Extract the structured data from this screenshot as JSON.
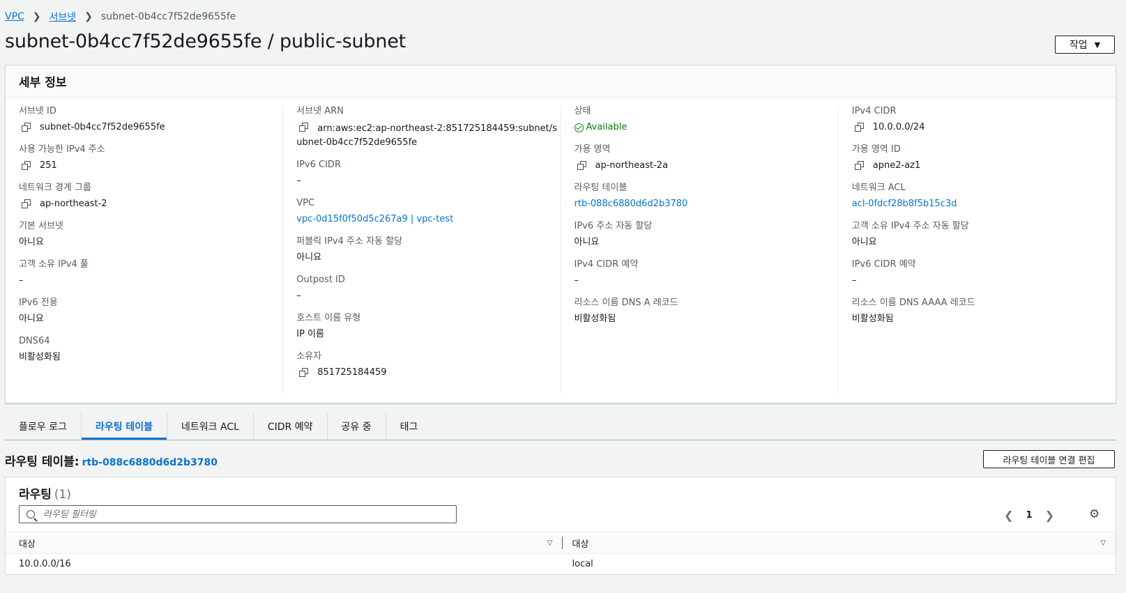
{
  "breadcrumb": {
    "items": [
      "VPC",
      "서브넷"
    ],
    "current": "subnet-0b4cc7f52de9655fe"
  },
  "title": "subnet-0b4cc7f52de9655fe / public-subnet",
  "actions_label": "작업",
  "details": {
    "header": "세부 정보",
    "col1": [
      {
        "label": "서브넷 ID",
        "value": "subnet-0b4cc7f52de9655fe"
      },
      {
        "label": "사용 가능한 IPv4 주소",
        "value": "251"
      },
      {
        "label": "네트워크 경계 그룹",
        "value": "ap-northeast-2"
      },
      {
        "label": "기본 서브넷",
        "value": "아니요"
      },
      {
        "label": "고객 소유 IPv4 풀",
        "value": "–"
      },
      {
        "label": "IPv6 전용",
        "value": "아니요"
      },
      {
        "label": "DNS64",
        "value": "비활성화됨"
      }
    ],
    "col2": [
      {
        "label": "서브넷 ARN",
        "value": "arn:aws:ec2:ap-northeast-2:851725184459:subnet/subnet-0b4cc7f52de9655fe"
      },
      {
        "label": "IPv6 CIDR",
        "value": "–"
      },
      {
        "label": "VPC",
        "value": "vpc-0d15f0f50d5c267a9 | vpc-test"
      },
      {
        "label": "퍼블릭 IPv4 주소 자동 할당",
        "value": "아니요"
      },
      {
        "label": "Outpost ID",
        "value": "–"
      },
      {
        "label": "호스트 이름 유형",
        "value": "IP 이름"
      },
      {
        "label": "소유자",
        "value": "851725184459"
      }
    ],
    "col3": [
      {
        "label": "상태",
        "value": "Available"
      },
      {
        "label": "가용 영역",
        "value": "ap-northeast-2a"
      },
      {
        "label": "라우팅 테이블",
        "value": "rtb-088c6880d6d2b3780"
      },
      {
        "label": "IPv6 주소 자동 할당",
        "value": "아니요"
      },
      {
        "label": "IPv4 CIDR 예약",
        "value": "–"
      },
      {
        "label": "리소스 이름 DNS A 레코드",
        "value": "비활성화됨"
      }
    ],
    "col4": [
      {
        "label": "IPv4 CIDR",
        "value": "10.0.0.0/24"
      },
      {
        "label": "가용 영역 ID",
        "value": "apne2-az1"
      },
      {
        "label": "네트워크 ACL",
        "value": "acl-0fdcf28b8f5b15c3d"
      },
      {
        "label": "고객 소유 IPv4 주소 자동 할당",
        "value": "아니요"
      },
      {
        "label": "IPv6 CIDR 예약",
        "value": "–"
      },
      {
        "label": "리소스 이름 DNS AAAA 레코드",
        "value": "비활성화됨"
      }
    ]
  },
  "tabs": [
    "플로우 로그",
    "라우팅 테이블",
    "네트워크 ACL",
    "CIDR 예약",
    "공유 중",
    "태그"
  ],
  "route_table": {
    "label": "라우팅 테이블:",
    "id": "rtb-088c6880d6d2b3780",
    "edit_button": "라우팅 테이블 연결 편집"
  },
  "routes": {
    "title": "라우팅",
    "count": "(1)",
    "filter_placeholder": "라우팅 필터링",
    "page": "1",
    "columns": [
      "대상",
      "대상"
    ],
    "rows": [
      [
        "10.0.0.0/16",
        "local"
      ]
    ]
  },
  "colors": {
    "link": "#0972d3",
    "success": "#037f0c",
    "background": "#f2f3f3"
  }
}
